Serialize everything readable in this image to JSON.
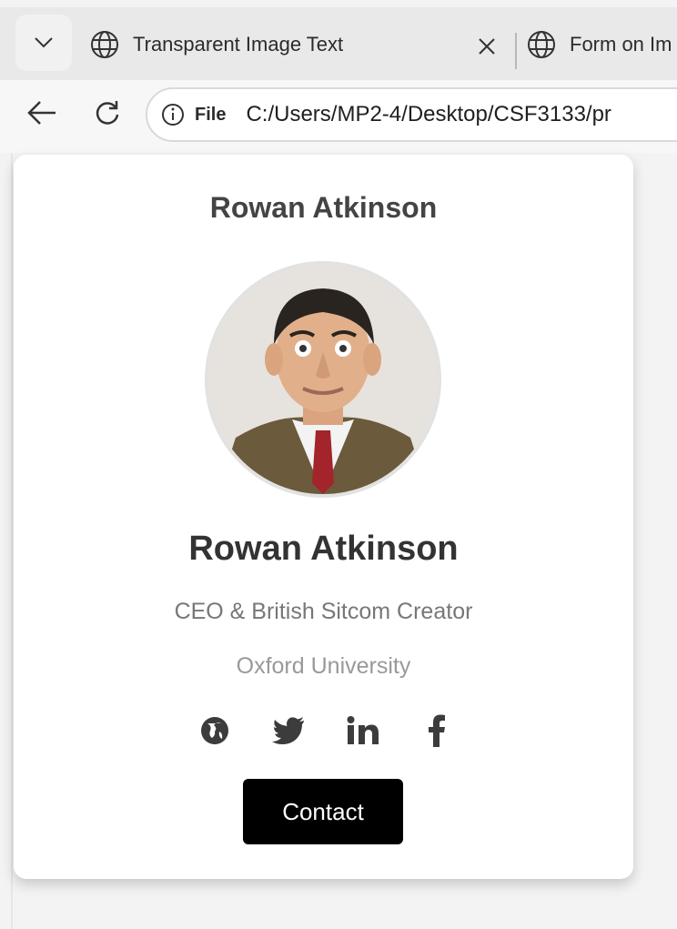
{
  "browser": {
    "tabs": [
      {
        "title": "Transparent Image Text",
        "active": true
      },
      {
        "title": "Form on Im",
        "active": false
      }
    ],
    "address": {
      "site_label": "File",
      "url": "C:/Users/MP2-4/Desktop/CSF3133/pr"
    }
  },
  "card": {
    "header_title": "Rowan Atkinson",
    "name": "Rowan Atkinson",
    "title": "CEO & British Sitcom Creator",
    "school": "Oxford University",
    "social_links": [
      "globe-icon",
      "twitter-icon",
      "linkedin-icon",
      "facebook-icon"
    ],
    "contact_label": "Contact",
    "contact_bg": "#000000",
    "contact_text": "#ffffff"
  }
}
